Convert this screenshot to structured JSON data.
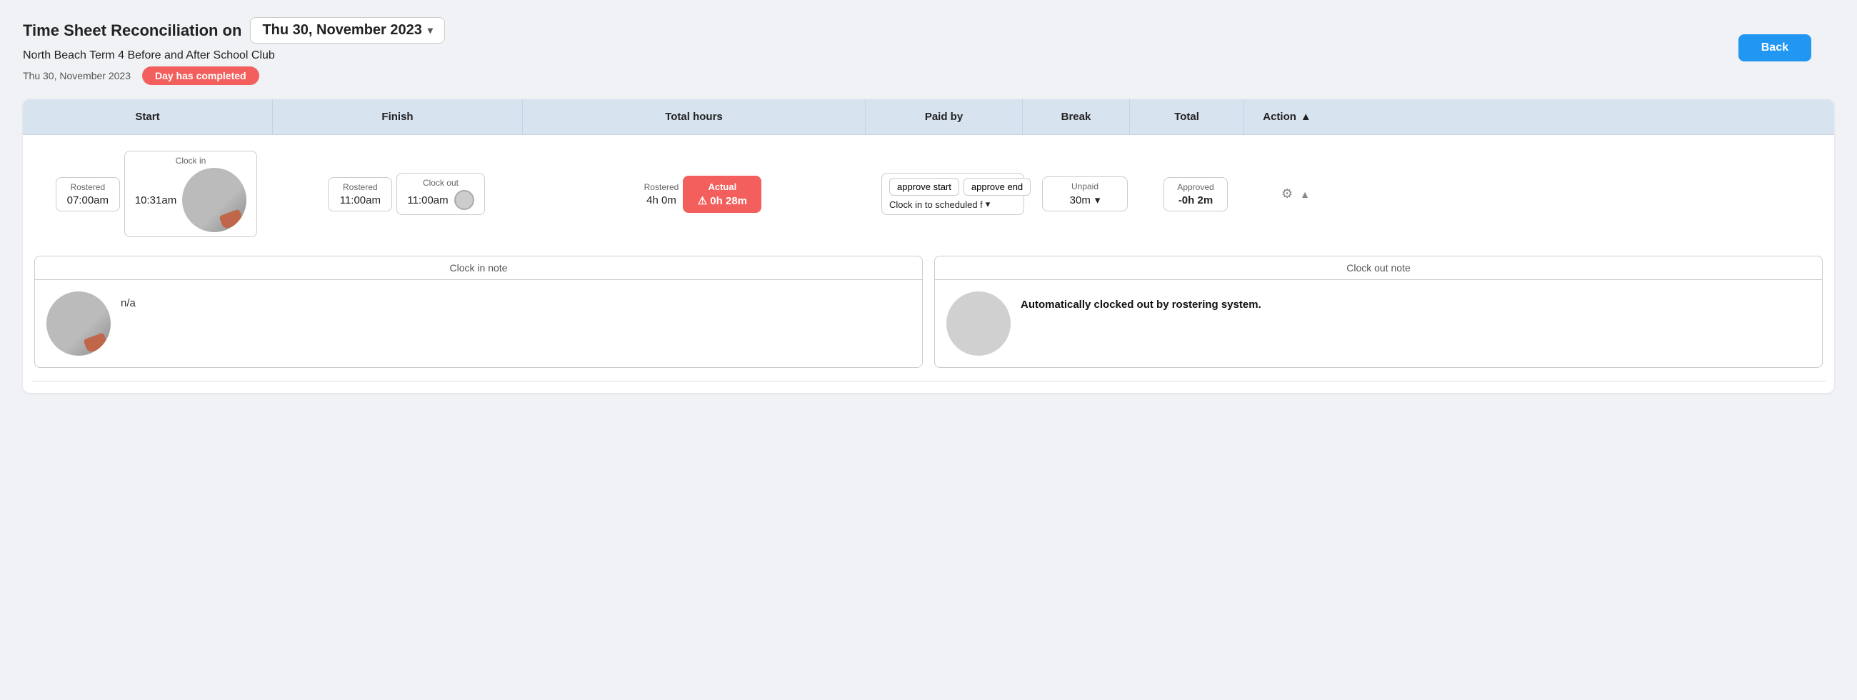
{
  "header": {
    "title_prefix": "Time Sheet Reconciliation on",
    "date_dropdown": "Thu 30, November 2023",
    "subtitle": "North Beach Term 4 Before and After School Club",
    "meta_date": "Thu 30, November 2023",
    "badge": "Day has completed",
    "back_button": "Back"
  },
  "table": {
    "columns": {
      "start": "Start",
      "finish": "Finish",
      "total_hours": "Total hours",
      "paid_by": "Paid by",
      "break": "Break",
      "total": "Total",
      "action": "Action"
    },
    "row": {
      "rostered_start": "07:00am",
      "clock_in": "10:31am",
      "rostered_finish": "11:00am",
      "clock_out": "11:00am",
      "rostered_hours": "4h 0m",
      "actual_hours": "⚠ 0h 28m",
      "approve_start": "approve start",
      "approve_end": "approve end",
      "paid_by_value": "Clock in to scheduled f",
      "break_label": "Unpaid",
      "break_value": "30m",
      "total_label": "Approved",
      "total_value": "-0h 2m",
      "start_label": "Rostered",
      "clock_in_label": "Clock in",
      "finish_label": "Rostered",
      "clock_out_label": "Clock out",
      "rostered_label": "Rostered",
      "actual_label": "Actual"
    }
  },
  "notes": {
    "clock_in_note_label": "Clock in note",
    "clock_in_note_text": "n/a",
    "clock_out_note_label": "Clock out note",
    "clock_out_note_text": "Automatically clocked out by rostering system."
  }
}
